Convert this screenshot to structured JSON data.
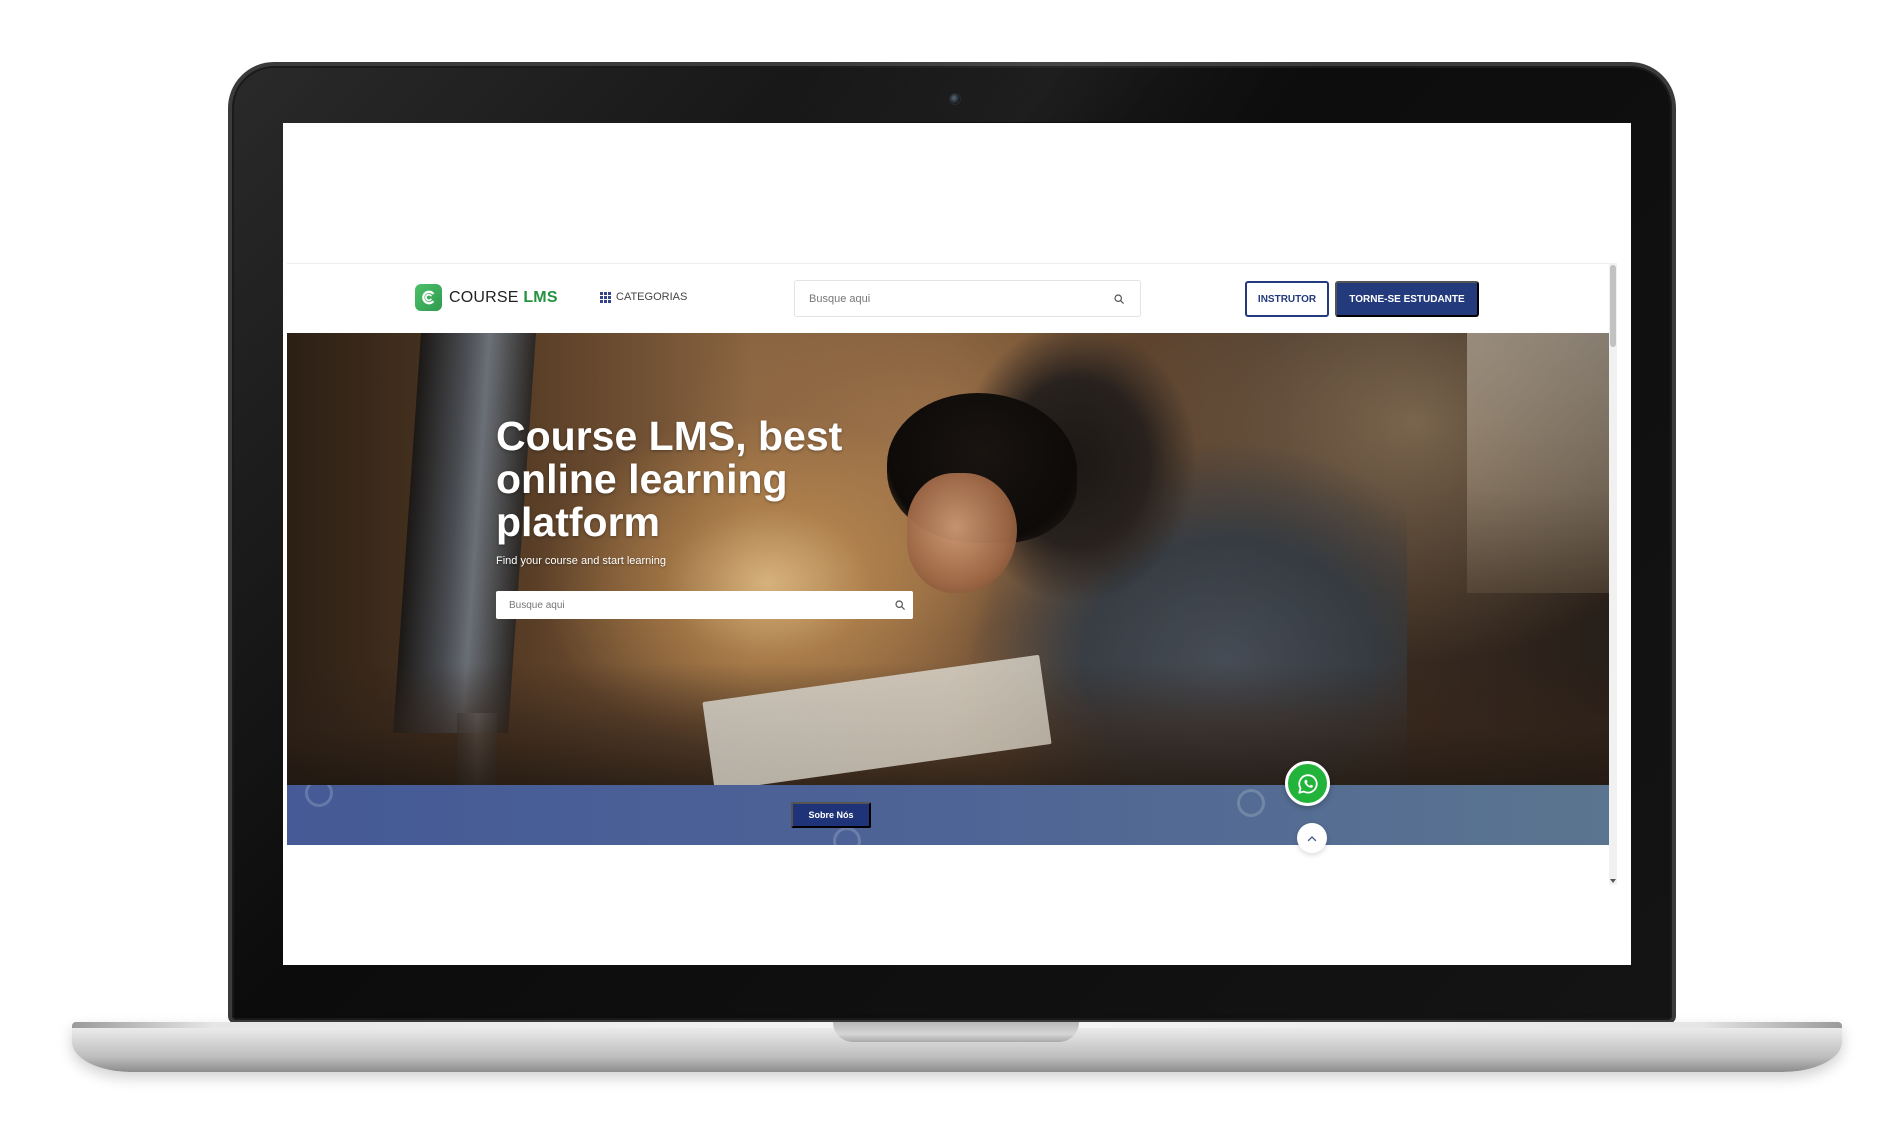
{
  "navbar": {
    "logo_text_plain": "COURSE ",
    "logo_text_accent": "LMS",
    "categories_label": "CATEGORIAS",
    "search_placeholder": "Busque aqui",
    "instructor_button": "INSTRUTOR",
    "student_button": "TORNE-SE ESTUDANTE"
  },
  "hero": {
    "title": "Course LMS, best online learning platform",
    "subtitle": "Find your course and start learning",
    "search_placeholder": "Busque aqui"
  },
  "about_band": {
    "button_label": "Sobre Nós"
  },
  "floating": {
    "whatsapp_icon": "whatsapp-icon",
    "back_to_top_icon": "chevron-up-icon"
  },
  "colors": {
    "primary": "#233b7d",
    "brand_green": "#24923e",
    "band_blue": "#4e6496",
    "whatsapp_green": "#22b33a"
  }
}
